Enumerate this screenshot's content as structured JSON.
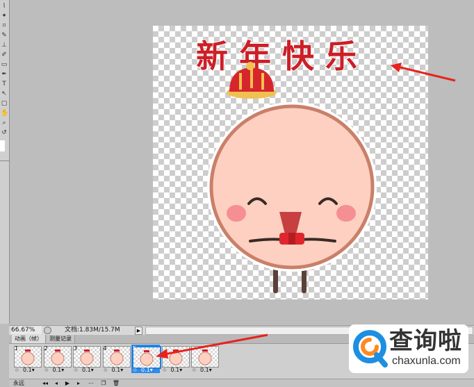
{
  "canvas": {
    "greeting_text": "新 年 快 乐"
  },
  "status": {
    "zoom": "66.67%",
    "doc_info": "文档:1.83M/15.7M"
  },
  "panel": {
    "tab_animation": "动画（帧）",
    "tab_history": "测量记录",
    "loop_option": "永远",
    "frames": [
      {
        "num": "1",
        "time": "0.1▾"
      },
      {
        "num": "2",
        "time": "0.1▾"
      },
      {
        "num": "3",
        "time": "0.1▾"
      },
      {
        "num": "4",
        "time": "0.1▾"
      },
      {
        "num": "5",
        "time": "0.1▾"
      },
      {
        "num": "",
        "time": "0.1▾"
      },
      {
        "num": "",
        "time": "0.1▾"
      }
    ],
    "selected_frame": 5
  },
  "watermark": {
    "cn": "查询啦",
    "url": "chaxunla.com"
  },
  "colors": {
    "face": "#fdd0c1",
    "face_outline": "#c9806a",
    "greeting": "#cc1f27",
    "arrow": "#e8221c",
    "selection": "#2f8ae8",
    "watermark_blue": "#1e8fe0",
    "watermark_orange": "#ff8a1f"
  }
}
